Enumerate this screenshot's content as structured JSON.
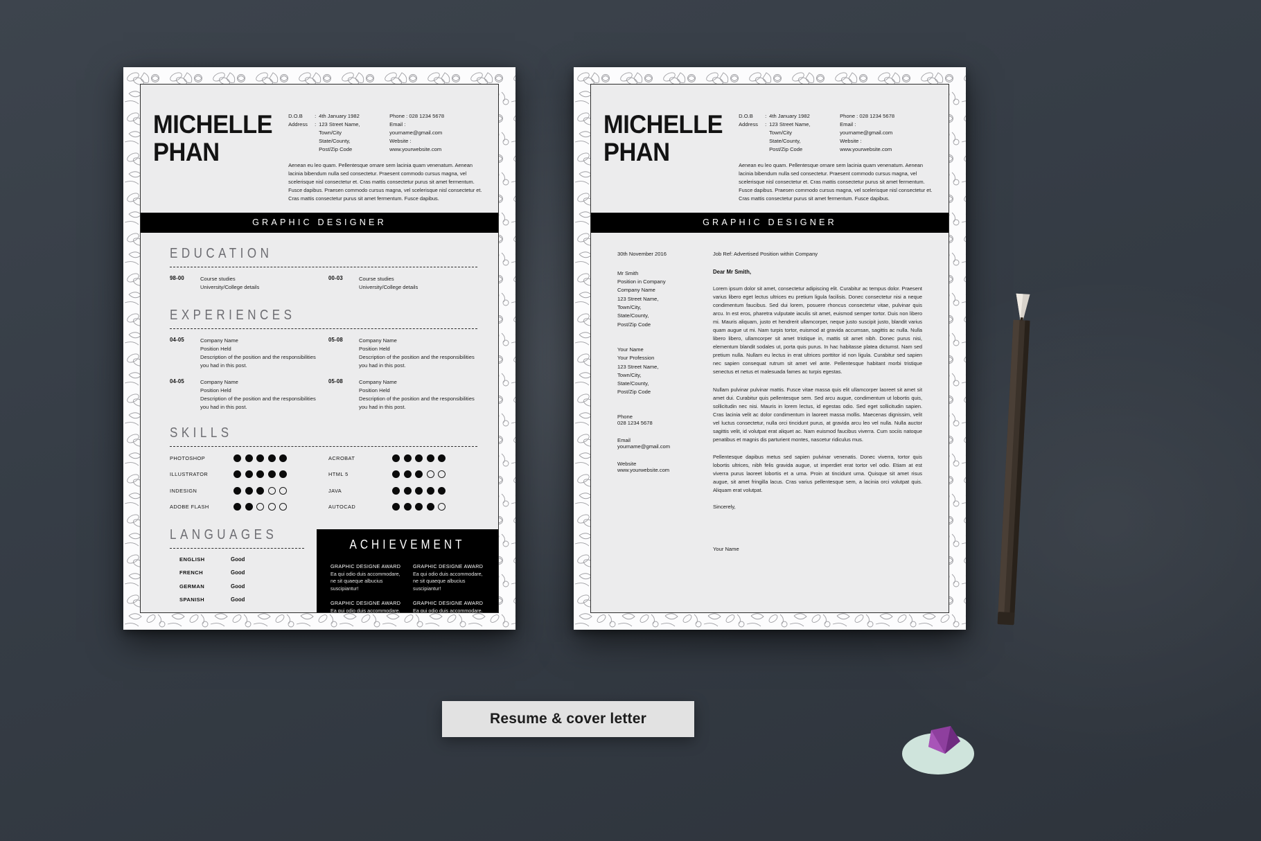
{
  "caption": {
    "text": "Resume & cover letter"
  },
  "resume": {
    "name_line1": "MICHELLE",
    "name_line2": "PHAN",
    "contacts": {
      "dob_key": "D.O.B",
      "dob_sep": ":",
      "dob_value": "4th January 1982",
      "address_key": "Address",
      "address_sep": ":",
      "address_value": "123 Street Name,",
      "address_line2": "Town/City",
      "address_line3": "State/County,",
      "address_line4": "Post/Zip Code",
      "phone": "Phone : 028 1234 5678",
      "email_label": "Email :",
      "email_value": "yourname@gmail.com",
      "website_label": "Website :",
      "website_value": "www.yourwebsite.com"
    },
    "bio": "Aenean eu leo quam. Pellentesque ornare sem lacinia quam venenatum. Aenean lacinia bibendum nulla sed consectetur. Praesent commodo cursus magna, vel scelerisque nisl consectetur et. Cras mattis consectetur purus sit amet fermentum. Fusce dapibus. Praesen  commodo cursus magna, vel scelerisque nisl consectetur et. Cras mattis consectetur purus sit amet fermentum. Fusce dapibus.",
    "job_title_bar": "GRAPHIC DESIGNER",
    "sections": {
      "education_title": "EDUCATION",
      "experiences_title": "EXPERIENCES",
      "skills_title": "SKILLS",
      "languages_title": "LANGUAGES",
      "achievement_title": "ACHIEVEMENT"
    },
    "education": [
      {
        "years": "98-00",
        "line1": "Course studies",
        "line2": "University/College details"
      },
      {
        "years": "00-03",
        "line1": "Course studies",
        "line2": "University/College details"
      }
    ],
    "experiences": [
      {
        "years": "04-05",
        "company": "Company Name",
        "position": "Position Held",
        "desc": "Description of the position and the responsibilities you had in this post."
      },
      {
        "years": "05-08",
        "company": "Company Name",
        "position": "Position Held",
        "desc": "Description of the position and the responsibilities you had in this post."
      },
      {
        "years": "04-05",
        "company": "Company Name",
        "position": "Position Held",
        "desc": "Description of the position and the responsibilities you had in this post."
      },
      {
        "years": "05-08",
        "company": "Company Name",
        "position": "Position Held",
        "desc": "Description of the position and the responsibilities you had in this post."
      }
    ],
    "skills_left": [
      {
        "name": "PHOTOSHOP",
        "rating": 5,
        "max": 5
      },
      {
        "name": "ILLUSTRATOR",
        "rating": 5,
        "max": 5
      },
      {
        "name": "INDESIGN",
        "rating": 3,
        "max": 5
      },
      {
        "name": "ADOBE FLASH",
        "rating": 2,
        "max": 5
      }
    ],
    "skills_right": [
      {
        "name": "ACROBAT",
        "rating": 5,
        "max": 5
      },
      {
        "name": "HTML 5",
        "rating": 3,
        "max": 5
      },
      {
        "name": "JAVA",
        "rating": 5,
        "max": 5
      },
      {
        "name": "AUTOCAD",
        "rating": 4,
        "max": 5
      }
    ],
    "languages": [
      {
        "name": "ENGLISH",
        "level": "Good"
      },
      {
        "name": "FRENCH",
        "level": "Good"
      },
      {
        "name": "GERMAN",
        "level": "Good"
      },
      {
        "name": "SPANISH",
        "level": "Good"
      }
    ],
    "achievements": [
      {
        "title": "GRAPHIC DESIGNE  AWARD",
        "desc": "Ea qui odio duis accommodare, ne sit quaeque albucius suscipiantur!"
      },
      {
        "title": "GRAPHIC DESIGNE  AWARD",
        "desc": "Ea qui odio duis accommodare, ne sit quaeque albucius suscipiantur!"
      },
      {
        "title": "GRAPHIC DESIGNE  AWARD",
        "desc": "Ea qui odio duis accommodare, ne sit quaeque albucius suscipiantur!"
      },
      {
        "title": "GRAPHIC DESIGNE  AWARD",
        "desc": "Ea qui odio duis accommodare, ne sit quaeque albucius suscipiantur!"
      }
    ]
  },
  "cover": {
    "name_line1": "MICHELLE",
    "name_line2": "PHAN",
    "job_title_bar": "GRAPHIC DESIGNER",
    "date": "30th November 2016",
    "job_ref": "Job Ref: Advertised Position within Company",
    "recipient": "Mr Smith\nPosition in Company\nCompany Name\n123 Street Name,\nTown/City,\nState/County,\nPost/Zip Code",
    "sender": "Your Name\nYour Profession\n123 Street Name,\nTown/City,\nState/County,\nPost/Zip Code",
    "phone_label": "Phone",
    "phone_value": "028 1234 5678",
    "email_label": "Email",
    "email_value": "yourname@gmail.com",
    "website_label": "Website",
    "website_value": "www.yourwebsite.com",
    "greeting": "Dear Mr Smith,",
    "paragraph1": "Lorem ipsum dolor sit amet, consectetur adipiscing elit. Curabitur ac tempus dolor. Praesent varius libero eget lectus ultrices eu pretium ligula facilisis. Donec consectetur nisi a neque condimentum faucibus. Sed dui lorem, posuere rhoncus consectetur vitae, pulvinar quis arcu. In est eros, pharetra vulputate iaculis sit amet, euismod semper tortor. Duis non libero mi. Mauris aliquam, justo et hendrerit ullamcorper, neque justo suscipit justo, blandit varius quam augue ut mi. Nam turpis tortor, euismod at gravida accumsan, sagittis ac nulla. Nulla libero libero, ullamcorper sit amet tristique in, mattis sit amet nibh. Donec purus nisi, elementum blandit sodales ut, porta quis purus. In hac habitasse platea dictumst. Nam sed pretium nulla. Nullam eu lectus in erat ultrices porttitor id non ligula. Curabitur sed sapien nec sapien consequat rutrum sit amet vel ante. Pellentesque habitant morbi tristique senectus et netus et malesuada fames ac turpis egestas.",
    "paragraph2": "Nullam pulvinar pulvinar mattis. Fusce vitae massa quis elit ullamcorper laoreet sit amet sit amet dui. Curabitur quis pellentesque sem. Sed arcu augue, condimentum ut lobortis quis, sollicitudin nec nisi. Mauris in lorem lectus, id egestas odio. Sed eget sollicitudin sapien. Cras lacinia velit ac dolor condimentum in laoreet massa mollis. Maecenas dignissim, velit vel luctus consectetur, nulla orci tincidunt purus, at gravida arcu leo vel nulla. Nulla auctor sagittis velit, id volutpat erat aliquet ac. Nam euismod faucibus viverra. Cum sociis natoque penatibus et magnis dis parturient montes, nascetur ridiculus mus.",
    "paragraph3": "Pellentesque dapibus metus sed sapien pulvinar venenatis. Donec viverra, tortor quis lobortis ultrices, nibh felis gravida augue, ut imperdiet erat tortor vel odio. Etiam at est viverra purus laoreet lobortis et a urna. Proin at tincidunt urna. Quisque sit amet risus augue, sit amet fringilla lacus. Cras varius pellentesque sem, a lacinia orci volutpat quis. Aliquam erat volutpat.",
    "closing": "Sincerely,",
    "signature": "Your Name"
  },
  "colors": {
    "background": "#343b44",
    "paper": "#ececed",
    "accent_black": "#000000",
    "section_heading": "#6d6d72"
  }
}
